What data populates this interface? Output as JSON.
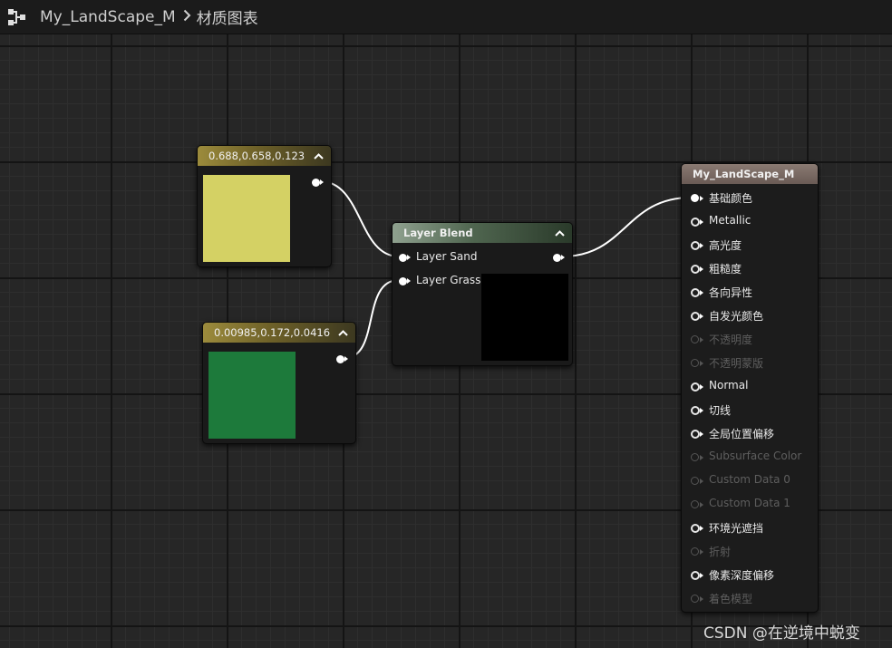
{
  "breadcrumb": {
    "asset": "My_LandScape_M",
    "graph": "材质图表"
  },
  "nodes": {
    "color_yellow": {
      "title": "0.688,0.658,0.123",
      "color": "#d4d164"
    },
    "color_green": {
      "title": "0.00985,0.172,0.0416",
      "color": "#1d7a3b"
    },
    "layer_blend": {
      "title": "Layer Blend",
      "inputs": [
        "Layer Sand",
        "Layer Grass"
      ]
    },
    "material": {
      "title": "My_LandScape_M",
      "pins": [
        {
          "label": "基础颜色",
          "active": true
        },
        {
          "label": "Metallic",
          "active": true
        },
        {
          "label": "高光度",
          "active": true
        },
        {
          "label": "粗糙度",
          "active": true
        },
        {
          "label": "各向异性",
          "active": true
        },
        {
          "label": "自发光颜色",
          "active": true
        },
        {
          "label": "不透明度",
          "active": false
        },
        {
          "label": "不透明蒙版",
          "active": false
        },
        {
          "label": "Normal",
          "active": true
        },
        {
          "label": "切线",
          "active": true
        },
        {
          "label": "全局位置偏移",
          "active": true
        },
        {
          "label": "Subsurface Color",
          "active": false
        },
        {
          "label": "Custom Data 0",
          "active": false
        },
        {
          "label": "Custom Data 1",
          "active": false
        },
        {
          "label": "环境光遮挡",
          "active": true
        },
        {
          "label": "折射",
          "active": false
        },
        {
          "label": "像素深度偏移",
          "active": true
        },
        {
          "label": "着色模型",
          "active": false
        }
      ]
    }
  },
  "watermark": "CSDN @在逆境中蜕变"
}
